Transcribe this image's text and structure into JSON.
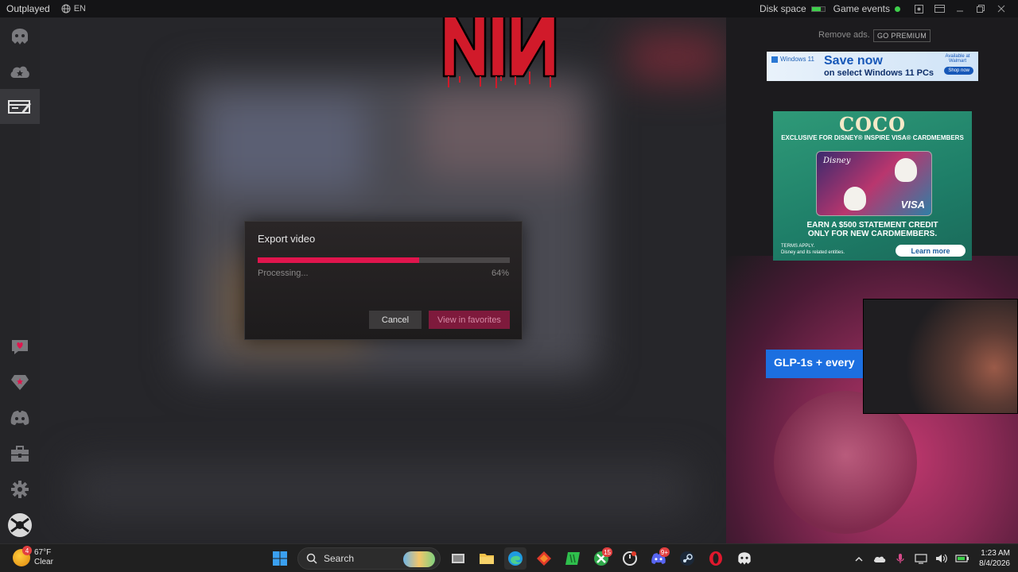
{
  "topbar": {
    "app_name": "Outplayed",
    "language": "EN",
    "disk_space_label": "Disk space",
    "disk_space_level": 0.7,
    "game_events_label": "Game events",
    "status_color": "#3ecf4b"
  },
  "sidebar": {
    "items": [
      {
        "icon": "overwolf-logo-icon"
      },
      {
        "icon": "cloud-icon"
      },
      {
        "icon": "media-editor-icon",
        "active": true
      },
      {
        "icon": "heart-message-icon"
      },
      {
        "icon": "gem-icon"
      },
      {
        "icon": "discord-icon"
      },
      {
        "icon": "toolbox-icon"
      },
      {
        "icon": "gear-icon"
      },
      {
        "icon": "user-avatar-icon"
      }
    ]
  },
  "dialog": {
    "title": "Export video",
    "status": "Processing...",
    "percent_text": "64%",
    "progress": 0.64,
    "cancel_label": "Cancel",
    "favorites_label": "View in favorites",
    "accent_color": "#e0154d"
  },
  "ads": {
    "remove_ads": "Remove ads.",
    "go_premium": "GO PREMIUM",
    "top": {
      "brand": "Windows 11",
      "headline": "Save now",
      "subline": "on select Windows 11 PCs",
      "retailer": "Available at Walmart",
      "cta": "Shop now"
    },
    "coco": {
      "title": "COCO",
      "subtitle": "EXCLUSIVE FOR DISNEY® INSPIRE VISA® CARDMEMBERS",
      "card_brand": "Disney",
      "card_network": "VISA",
      "earn_line1": "EARN A $500 STATEMENT CREDIT",
      "earn_line2": "ONLY FOR NEW CARDMEMBERS.",
      "terms": "TERMS APPLY.",
      "terms_sub": "Disney and its related entities.",
      "cta": "Learn more"
    },
    "glp": {
      "text": "GLP-1s + every"
    }
  },
  "taskbar": {
    "weather_temp": "67°F",
    "weather_desc": "Clear",
    "weather_badge": "4",
    "search_label": "Search",
    "xbox_badge": "15",
    "discord_badge": "9+",
    "time": "1:23 AM",
    "date": "8/4/2026"
  }
}
